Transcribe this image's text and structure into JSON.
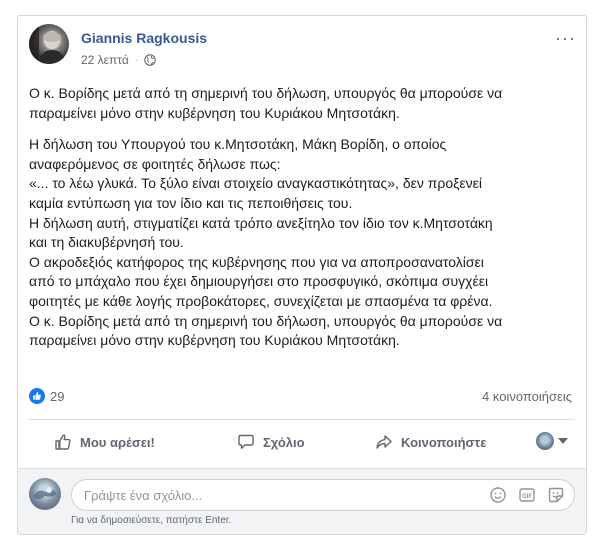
{
  "post": {
    "author": "Giannis Ragkousis",
    "timestamp": "22 λεπτά",
    "more_label": "···",
    "paragraph1": [
      "Ο κ. Βορίδης μετά από τη σημερινή του δήλωση, υπουργός θα μπορούσε να",
      "παραμείνει μόνο στην κυβέρνηση του Κυριάκου Μητσοτάκη."
    ],
    "paragraph2": [
      "Η δήλωση του Υπουργού του κ.Μητσοτάκη, Μάκη Βορίδη, ο οποίος",
      "αναφερόμενος σε φοιτητές δήλωσε πως:",
      "«... το λέω γλυκά. Το ξύλο είναι στοιχείο αναγκαστικότητας», δεν προξενεί",
      "καμία εντύπωση για τον ίδιο και τις πεποιθήσεις του.",
      "Η δήλωση αυτή, στιγματίζει κατά τρόπο ανεξίτηλο τον ίδιο τον κ.Μητσοτάκη",
      "και τη διακυβέρνησή του.",
      "Ο ακροδεξιός κατήφορος της κυβέρνησης που για να αποπροσανατολίσει",
      "από το μπάχαλο που έχει δημιουργήσει στο προσφυγικό, σκόπιμα συγχέει",
      "φοιτητές με κάθε λογής προβοκάτορες, συνεχίζεται με σπασμένα τα φρένα.",
      "Ο κ. Βορίδης μετά από τη σημερινή του δήλωση, υπουργός θα μπορούσε να",
      "παραμείνει μόνο στην κυβέρνηση του Κυριάκου Μητσοτάκη."
    ]
  },
  "stats": {
    "likes": "29",
    "shares": "4 κοινοποιήσεις"
  },
  "actions": {
    "like": "Μου αρέσει!",
    "comment": "Σχόλιο",
    "share": "Κοινοποιήστε"
  },
  "comment_box": {
    "placeholder": "Γράψτε ένα σχόλιο...",
    "hint": "Για να δημοσιεύσετε, πατήστε Enter."
  },
  "colors": {
    "author_link": "#385898",
    "like_badge": "#1877f2",
    "secondary_text": "#606770",
    "footer_bg": "#f2f3f5"
  },
  "icons": {
    "privacy": "globe-icon",
    "more": "more-options-icon",
    "like_badge": "thumbs-up-badge-icon",
    "like_action": "thumbs-up-icon",
    "comment_action": "speech-bubble-icon",
    "share_action": "share-arrow-icon",
    "emoji": "emoji-icon",
    "gif": "gif-icon",
    "sticker": "sticker-icon"
  }
}
